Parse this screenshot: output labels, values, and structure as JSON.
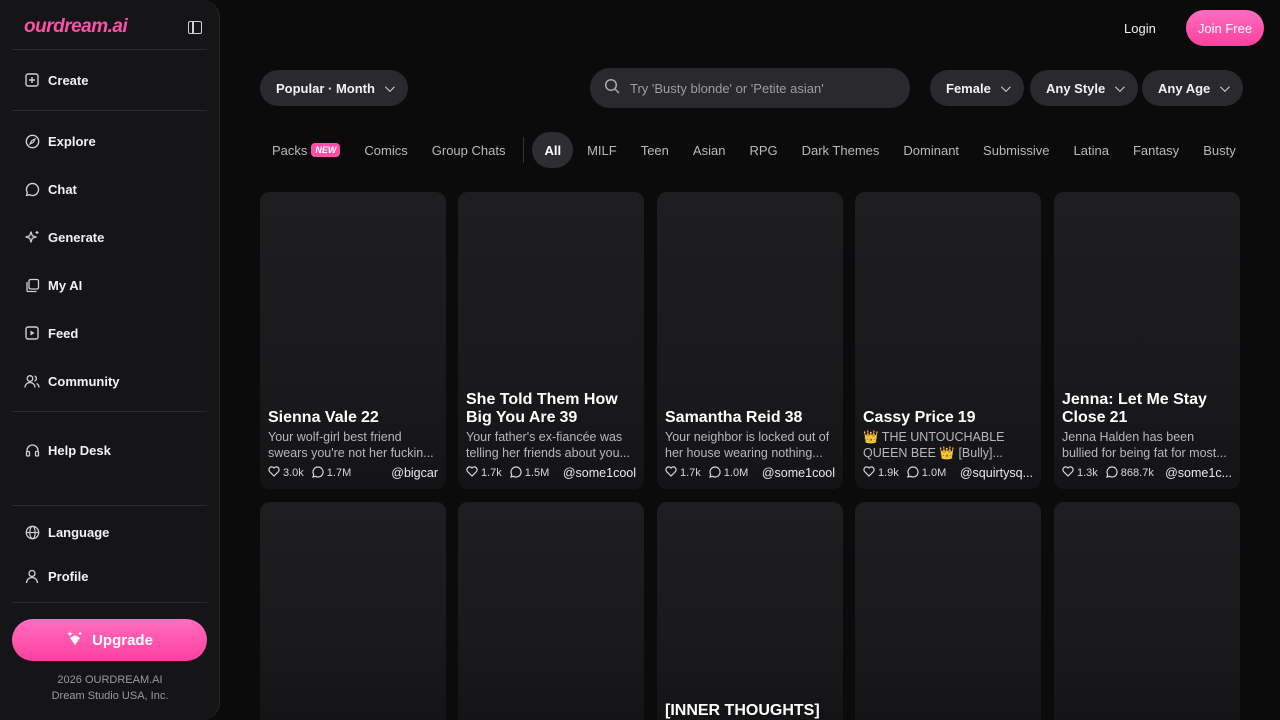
{
  "brand": {
    "logo_main": "ourdream",
    "logo_suffix": ".ai"
  },
  "sidebar": {
    "items": [
      {
        "label": "Create",
        "icon": "plus-square-icon"
      },
      {
        "label": "Explore",
        "icon": "compass-icon"
      },
      {
        "label": "Chat",
        "icon": "chat-bubble-icon"
      },
      {
        "label": "Generate",
        "icon": "sparkle-icon"
      },
      {
        "label": "My AI",
        "icon": "stack-icon"
      },
      {
        "label": "Feed",
        "icon": "play-square-icon"
      },
      {
        "label": "Community",
        "icon": "users-icon"
      },
      {
        "label": "Help Desk",
        "icon": "headset-icon"
      },
      {
        "label": "Language",
        "icon": "globe-icon"
      },
      {
        "label": "Profile",
        "icon": "user-icon"
      }
    ],
    "upgrade_label": "Upgrade",
    "footer_line1": "2026 OURDREAM.AI",
    "footer_line2": "Dream Studio USA, Inc."
  },
  "header": {
    "login_label": "Login",
    "join_label": "Join Free"
  },
  "filters": {
    "sort_label": "Popular · Month",
    "search_placeholder": "Try 'Busty blonde' or 'Petite asian'",
    "gender_label": "Female",
    "style_label": "Any Style",
    "age_label": "Any Age"
  },
  "tabs": {
    "packs": "Packs",
    "packs_badge": "NEW",
    "comics": "Comics",
    "group_chats": "Group Chats",
    "categories": [
      "All",
      "MILF",
      "Teen",
      "Asian",
      "RPG",
      "Dark Themes",
      "Dominant",
      "Submissive",
      "Latina",
      "Fantasy",
      "Busty"
    ]
  },
  "cards": [
    {
      "name": "Sienna Vale",
      "age": "22",
      "desc": "Your wolf-girl best friend swears you're not her fuckin...",
      "likes": "3.0k",
      "chats": "1.7M",
      "creator": "@bigcar"
    },
    {
      "name": "She Told Them How Big You Are",
      "age": "39",
      "desc": "Your father's ex-fiancée was telling her friends about you...",
      "likes": "1.7k",
      "chats": "1.5M",
      "creator": "@some1cool"
    },
    {
      "name": "Samantha Reid",
      "age": "38",
      "desc": "Your neighbor is locked out of her house wearing nothing...",
      "likes": "1.7k",
      "chats": "1.0M",
      "creator": "@some1cool"
    },
    {
      "name": "Cassy Price",
      "age": "19",
      "desc": "👑 THE UNTOUCHABLE QUEEN BEE 👑 [Bully]...",
      "likes": "1.9k",
      "chats": "1.0M",
      "creator": "@squirtysq..."
    },
    {
      "name": "Jenna: Let Me Stay Close",
      "age": "21",
      "desc": "Jenna Halden has been bullied for being fat for most...",
      "likes": "1.3k",
      "chats": "868.7k",
      "creator": "@some1c..."
    }
  ],
  "row2": {
    "partial_title": "[INNER THOUGHTS]"
  }
}
